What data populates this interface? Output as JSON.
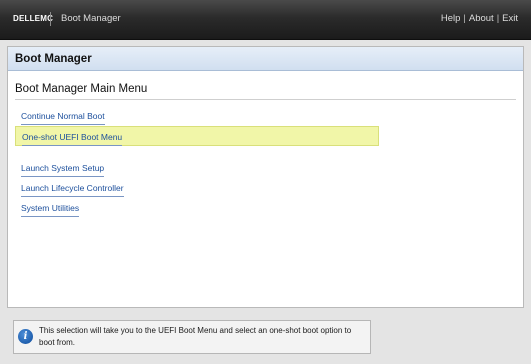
{
  "header": {
    "brand": "DELLEMC",
    "app_title": "Boot Manager",
    "links": [
      "Help",
      "About",
      "Exit"
    ],
    "separator": "|"
  },
  "panel": {
    "title": "Boot Manager",
    "section_title": "Boot Manager Main Menu",
    "menu_items": [
      {
        "label": "Continue Normal Boot",
        "selected": false
      },
      {
        "label": "One-shot UEFI Boot Menu",
        "selected": true
      },
      {
        "label": "Launch System Setup",
        "selected": false
      },
      {
        "label": "Launch Lifecycle Controller",
        "selected": false
      },
      {
        "label": "System Utilities",
        "selected": false
      }
    ]
  },
  "info": {
    "icon": "info-icon",
    "text": "This selection will take you to the UEFI Boot Menu and select an one-shot boot option to boot from."
  },
  "colors": {
    "header_bg": "#1b1b1b",
    "panel_header_bg": "#d1dff0",
    "link": "#1c4f9c",
    "selected_bg": "#f1f6a8",
    "info_icon": "#1f5fae"
  }
}
